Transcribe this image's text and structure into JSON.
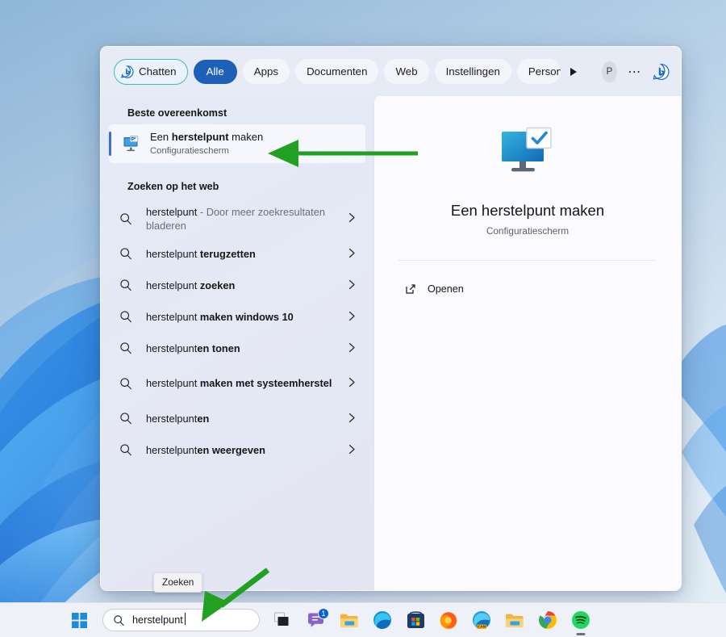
{
  "search_flyout": {
    "header": {
      "chat_pill": {
        "label": "Chatten",
        "icon": "bing-icon",
        "outline_color": "#3fbfae"
      },
      "tabs": [
        {
          "label": "Alle",
          "active": true
        },
        {
          "label": "Apps",
          "active": false
        },
        {
          "label": "Documenten",
          "active": false
        },
        {
          "label": "Web",
          "active": false
        },
        {
          "label": "Instellingen",
          "active": false
        },
        {
          "label": "Personen",
          "active": false
        }
      ],
      "more_tabs_icon": "play-triangle-icon",
      "avatar_initial": "P",
      "overflow_icon": "ellipsis-icon",
      "bing_icon": "bing-chat-icon",
      "active_pill_color": "#1e5fb8"
    },
    "results": {
      "best_match_title": "Beste overeenkomst",
      "best_match": {
        "title_prefix": "Een ",
        "title_bold": "herstelpunt",
        "title_suffix": " maken",
        "subtitle": "Configuratiescherm",
        "icon": "restore-point-monitor-icon",
        "accent_color": "#3a6fd8"
      },
      "web_section_title": "Zoeken op het web",
      "web_items": [
        {
          "plain": "herstelpunt",
          "bold": "",
          "muted": " - Door meer zoekresultaten bladeren",
          "icon": "search-icon",
          "chevron": "chevron-right-icon",
          "tall": true
        },
        {
          "plain": "herstelpunt ",
          "bold": "terugzetten",
          "muted": "",
          "icon": "search-icon",
          "chevron": "chevron-right-icon",
          "tall": false
        },
        {
          "plain": "herstelpunt ",
          "bold": "zoeken",
          "muted": "",
          "icon": "search-icon",
          "chevron": "chevron-right-icon",
          "tall": false
        },
        {
          "plain": "herstelpunt ",
          "bold": "maken windows 10",
          "muted": "",
          "icon": "search-icon",
          "chevron": "chevron-right-icon",
          "tall": false
        },
        {
          "plain": "herstelpunt",
          "bold": "en tonen",
          "muted": "",
          "icon": "search-icon",
          "chevron": "chevron-right-icon",
          "tall": false
        },
        {
          "plain": "herstelpunt ",
          "bold": "maken met systeemherstel",
          "muted": "",
          "icon": "search-icon",
          "chevron": "chevron-right-icon",
          "tall": true
        },
        {
          "plain": "herstelpunt",
          "bold": "en",
          "muted": "",
          "icon": "search-icon",
          "chevron": "chevron-right-icon",
          "tall": false
        },
        {
          "plain": "herstelpunt",
          "bold": "en weergeven",
          "muted": "",
          "icon": "search-icon",
          "chevron": "chevron-right-icon",
          "tall": false
        }
      ]
    },
    "preview": {
      "icon": "restore-point-monitor-large-icon",
      "title": "Een herstelpunt maken",
      "subtitle": "Configuratiescherm",
      "action_label": "Openen",
      "action_icon": "open-external-icon"
    }
  },
  "tooltip": {
    "label": "Zoeken"
  },
  "taskbar": {
    "start_icon": "windows-start-icon",
    "search": {
      "value": "herstelpunt",
      "icon": "search-icon"
    },
    "items": [
      {
        "name": "task-view-icon",
        "badge": ""
      },
      {
        "name": "chat-teams-icon",
        "badge": "1"
      },
      {
        "name": "file-explorer-icon",
        "badge": ""
      },
      {
        "name": "microsoft-edge-icon",
        "badge": ""
      },
      {
        "name": "microsoft-store-icon",
        "badge": ""
      },
      {
        "name": "firefox-icon",
        "badge": ""
      },
      {
        "name": "edge-canary-icon",
        "badge": ""
      },
      {
        "name": "folder-icon",
        "badge": ""
      },
      {
        "name": "google-chrome-icon",
        "badge": ""
      },
      {
        "name": "spotify-icon",
        "badge": "",
        "running": true
      }
    ]
  },
  "annotations": {
    "arrow_color": "#22a022",
    "arrow_to_best_match": "left-pointing-arrow",
    "arrow_to_search_box": "diagonal-arrow"
  }
}
